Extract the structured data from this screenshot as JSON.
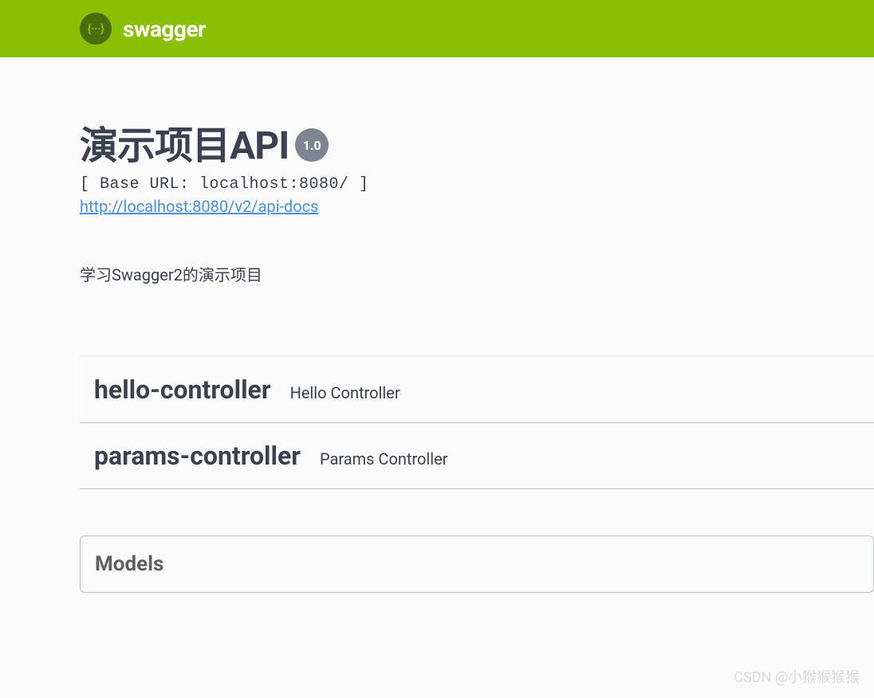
{
  "header": {
    "brand": "swagger"
  },
  "info": {
    "title": "演示项目API",
    "version": "1.0",
    "base_url_label": "[ Base URL: localhost:8080/ ]",
    "api_docs_link": "http://localhost:8080/v2/api-docs",
    "description": "学习Swagger2的演示项目"
  },
  "tags": [
    {
      "name": "hello-controller",
      "description": "Hello Controller"
    },
    {
      "name": "params-controller",
      "description": "Params Controller"
    }
  ],
  "models": {
    "title": "Models"
  },
  "watermark": "CSDN @小猴猴猴猴"
}
